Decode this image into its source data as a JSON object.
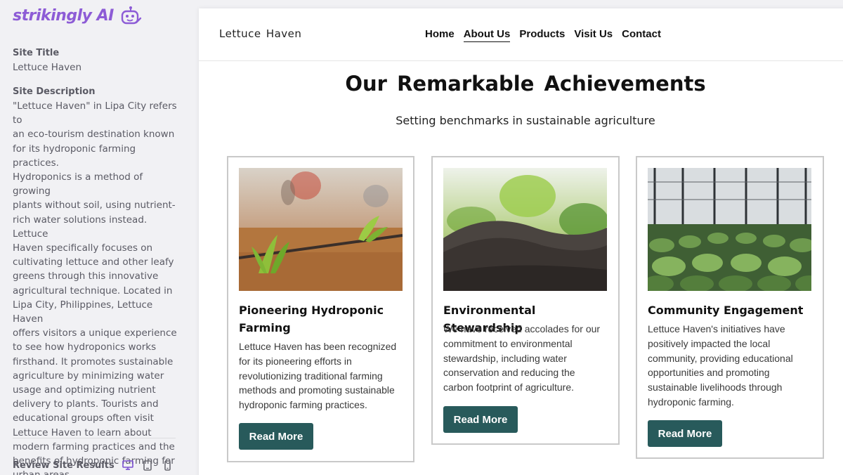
{
  "brand": {
    "name": "strikingly AI",
    "icon": "robot-icon",
    "color": "#8d5cd6"
  },
  "sidebar": {
    "site_title_label": "Site Title",
    "site_title_value": "Lettuce Haven",
    "site_description_label": "Site Description",
    "site_description_lines": [
      "\"Lettuce Haven\" in Lipa City refers to",
      "an eco-tourism destination known",
      "for its hydroponic farming practices.",
      "Hydroponics is a method of growing",
      "plants without soil, using nutrient-",
      "rich water solutions instead. Lettuce",
      "Haven specifically focuses on",
      "cultivating lettuce and other leafy",
      "greens through this innovative",
      "agricultural technique. Located in",
      "Lipa City, Philippines, Lettuce Haven",
      "offers visitors a unique experience",
      "to see how hydroponics works",
      "firsthand. It promotes sustainable",
      "agriculture by minimizing water",
      "usage and optimizing nutrient",
      "delivery to plants. Tourists and",
      "educational groups often visit",
      "Lettuce Haven to learn about",
      "modern farming practices and the",
      "benefits of hydroponic farming for",
      "urban areas."
    ],
    "review_label": "Review Site Results",
    "devices": [
      "desktop-icon",
      "tablet-icon",
      "mobile-icon"
    ]
  },
  "site": {
    "logo": "Lettuce Haven",
    "nav": [
      {
        "label": "Home",
        "active": false
      },
      {
        "label": "About Us",
        "active": true
      },
      {
        "label": "Products",
        "active": false
      },
      {
        "label": "Visit Us",
        "active": false
      },
      {
        "label": "Contact",
        "active": false
      }
    ],
    "title": "Our Remarkable Achievements",
    "subtitle": "Setting benchmarks in sustainable agriculture",
    "accent_color": "#285a5b",
    "cards": [
      {
        "title_lines": [
          "Pioneering Hydroponic",
          "Farming"
        ],
        "text_lines": [
          "Lettuce Haven has been recognized",
          "for its pioneering efforts in",
          "revolutionizing traditional farming",
          "methods and promoting sustainable",
          "hydroponic farming practices."
        ],
        "button": "Read More",
        "image": "seedlings-in-soil-photo"
      },
      {
        "title_lines": [
          "Environmental Stewardship"
        ],
        "text_lines": [
          "We have received accolades for our",
          "commitment to environmental",
          "stewardship, including water",
          "conservation and reducing the",
          "carbon footprint of agriculture."
        ],
        "button": "Read More",
        "image": "green-leaves-on-mesh-photo"
      },
      {
        "title_lines": [
          "Community Engagement"
        ],
        "text_lines": [
          "Lettuce Haven's initiatives have",
          "positively impacted the local",
          "community, providing educational",
          "opportunities and promoting",
          "sustainable livelihoods through",
          "hydroponic farming."
        ],
        "button": "Read More",
        "image": "greenhouse-lettuce-photo"
      }
    ]
  }
}
